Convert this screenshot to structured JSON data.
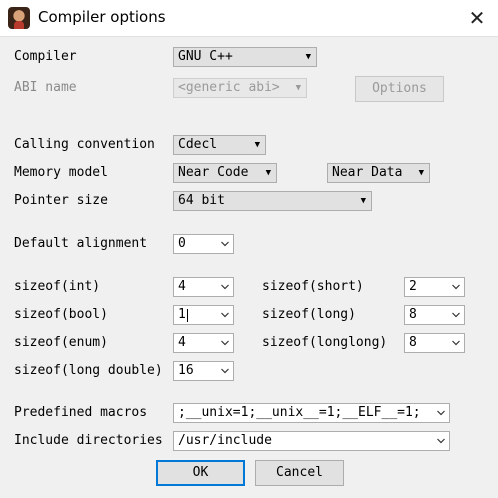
{
  "window": {
    "title": "Compiler options"
  },
  "compiler": {
    "label": "Compiler",
    "value": "GNU C++"
  },
  "abi": {
    "label": "ABI name",
    "value": "<generic abi>",
    "options_button": "Options"
  },
  "calling_convention": {
    "label": "Calling convention",
    "value": "Cdecl"
  },
  "memory_model": {
    "label": "Memory model",
    "code_value": "Near Code",
    "data_value": "Near Data"
  },
  "pointer_size": {
    "label": "Pointer size",
    "value": "64 bit"
  },
  "default_alignment": {
    "label": "Default alignment",
    "value": "0"
  },
  "sizes": {
    "int": {
      "label": "sizeof(int)",
      "value": "4"
    },
    "short": {
      "label": "sizeof(short)",
      "value": "2"
    },
    "bool": {
      "label": "sizeof(bool)",
      "value": "1"
    },
    "long": {
      "label": "sizeof(long)",
      "value": "8"
    },
    "enum": {
      "label": "sizeof(enum)",
      "value": "4"
    },
    "longlong": {
      "label": "sizeof(longlong)",
      "value": "8"
    },
    "long_double": {
      "label": "sizeof(long double)",
      "value": "16"
    }
  },
  "predefined_macros": {
    "label": "Predefined macros",
    "value": ";__unix=1;__unix__=1;__ELF__=1;"
  },
  "include_directories": {
    "label": "Include directories",
    "value": "/usr/include"
  },
  "buttons": {
    "ok": "OK",
    "cancel": "Cancel"
  },
  "icons": {
    "app": "app-avatar-icon",
    "close": "close-icon",
    "dropdown": "chevron-down-icon"
  },
  "colors": {
    "default_button_border": "#0078d7",
    "disabled_text": "#8a8a8a"
  }
}
